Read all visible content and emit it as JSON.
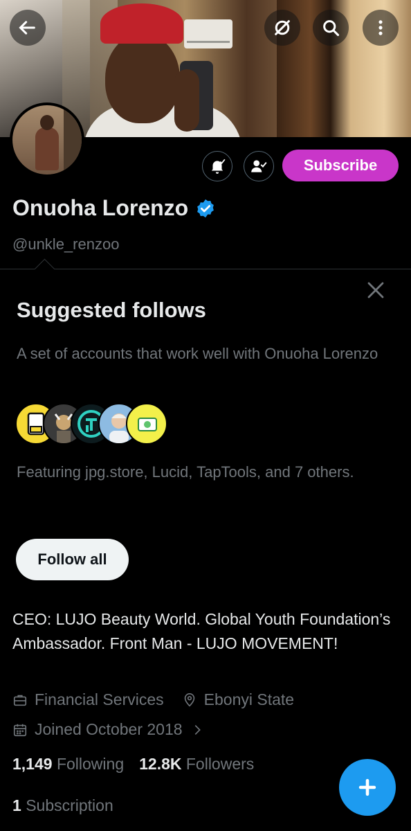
{
  "profile": {
    "name": "Onuoha Lorenzo",
    "handle": "@unkle_renzoo",
    "subscribe_label": "Subscribe",
    "bio": "CEO: LUJO Beauty World. Global Youth Foundation’s Ambassador. Front Man - LUJO MOVEMENT!",
    "category": "Financial Services",
    "location": "Ebonyi State",
    "joined": "Joined October 2018",
    "following_count": "1,149",
    "following_label": "Following",
    "followers_count": "12.8K",
    "followers_label": "Followers",
    "subscriptions_count": "1",
    "subscriptions_label": "Subscription"
  },
  "suggested": {
    "title": "Suggested follows",
    "description": "A set of accounts that work well with Onuoha Lorenzo",
    "featuring": "Featuring jpg.store, Lucid, TapTools, and 7 others.",
    "follow_all_label": "Follow all"
  },
  "icons": {
    "top_bar": [
      "back-arrow-icon",
      "grok-icon",
      "search-icon",
      "more-vertical-icon"
    ],
    "actions": [
      "notification-bell-icon",
      "following-person-icon"
    ],
    "meta": [
      "briefcase-icon",
      "location-pin-icon",
      "calendar-icon",
      "chevron-right-icon"
    ],
    "fab": "plus-icon"
  },
  "colors": {
    "subscribe": "#c936c9",
    "verified": "#1d9bf0",
    "fab": "#1d9bf0",
    "muted_text": "#71767b"
  }
}
